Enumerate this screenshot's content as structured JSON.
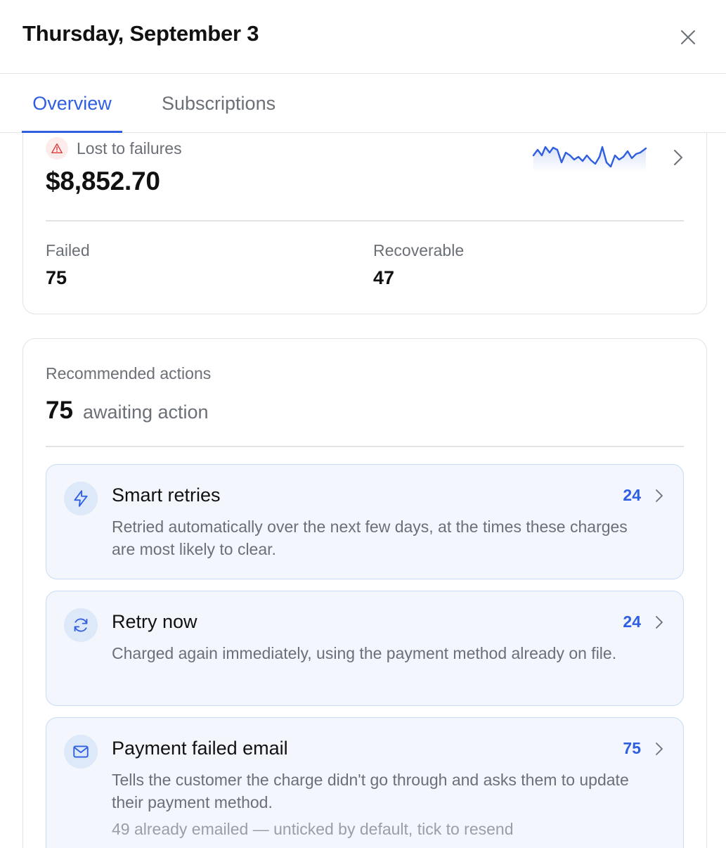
{
  "header": {
    "title": "Thursday, September 3"
  },
  "tabs": [
    {
      "label": "Overview",
      "active": true
    },
    {
      "label": "Subscriptions",
      "active": false
    }
  ],
  "lost": {
    "label": "Lost to failures",
    "amount": "$8,852.70",
    "stats": {
      "failed_label": "Failed",
      "failed_value": "75",
      "recoverable_label": "Recoverable",
      "recoverable_value": "47"
    }
  },
  "recommended": {
    "heading": "Recommended actions",
    "count": "75",
    "count_suffix": "awaiting action",
    "actions": [
      {
        "icon": "lightning-icon",
        "title": "Smart retries",
        "count": "24",
        "description": "Retried automatically over the next few days, at the times these charges are most likely to clear."
      },
      {
        "icon": "refresh-icon",
        "title": "Retry now",
        "count": "24",
        "description": "Charged again immediately, using the payment method already on file."
      },
      {
        "icon": "mail-icon",
        "title": "Payment failed email",
        "count": "75",
        "description": "Tells the customer the charge didn't go through and asks them to update their payment method.",
        "note": "49 already emailed — unticked by default, tick to resend"
      }
    ]
  },
  "colors": {
    "accent": "#2f5fe0",
    "warning": "#d93a3a",
    "action_bg": "#f3f7fd",
    "action_border": "#c9dcf5"
  }
}
